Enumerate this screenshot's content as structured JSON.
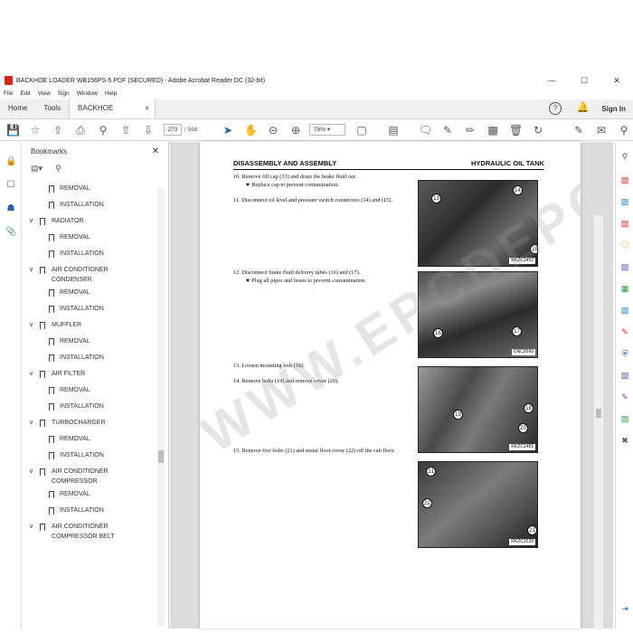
{
  "window": {
    "title": "BACKHOE LOADER WB156PS-5.PDF (SECURED) - Adobe Acrobat Reader DC (32-bit)",
    "controls": [
      "—",
      "☐",
      "✕"
    ]
  },
  "menu": [
    "File",
    "Edit",
    "View",
    "Sign",
    "Window",
    "Help"
  ],
  "tabs": {
    "home": "Home",
    "tools": "Tools",
    "doc": "BACKHOE LOADER...",
    "doc_close": "×",
    "sign_in": "Sign In"
  },
  "toolbar": {
    "page_current": "273",
    "page_total": "/ 568",
    "zoom": "78%"
  },
  "bookmarks": {
    "title": "Bookmarks",
    "items": [
      {
        "label": "REMOVAL",
        "level": 2
      },
      {
        "label": "INSTALLATION",
        "level": 2
      },
      {
        "label": "RADIATOR",
        "level": 1
      },
      {
        "label": "REMOVAL",
        "level": 2
      },
      {
        "label": "INSTALLATION",
        "level": 2
      },
      {
        "label": "AIR CONDITIONER",
        "label2": "CONDENSER",
        "level": 1
      },
      {
        "label": "REMOVAL",
        "level": 2
      },
      {
        "label": "INSTALLATION",
        "level": 2
      },
      {
        "label": "MUFFLER",
        "level": 1
      },
      {
        "label": "REMOVAL",
        "level": 2
      },
      {
        "label": "INSTALLATION",
        "level": 2
      },
      {
        "label": "AIR FILTER",
        "level": 1
      },
      {
        "label": "REMOVAL",
        "level": 2
      },
      {
        "label": "INSTALLATION",
        "level": 2
      },
      {
        "label": "TURBOCHARGER",
        "level": 1
      },
      {
        "label": "REMOVAL",
        "level": 2
      },
      {
        "label": "INSTALLATION",
        "level": 2
      },
      {
        "label": "AIR CONDITIONER",
        "label2": "COMPRESSOR",
        "level": 1
      },
      {
        "label": "REMOVAL",
        "level": 2
      },
      {
        "label": "INSTALLATION",
        "level": 2
      },
      {
        "label": "AIR CONDITIONER",
        "label2": "COMPRESSOR BELT",
        "level": 1
      }
    ]
  },
  "document": {
    "header_left": "DISASSEMBLY AND ASSEMBLY",
    "header_right": "HYDRAULIC OIL TANK",
    "steps": [
      {
        "num": "10.",
        "text": "Remove fill cap (13) and drain the brake fluid out.",
        "sub": "★   Replace cap to prevent contamination."
      },
      {
        "num": "11.",
        "text": "Disconnect oil level and pressure switch connectors (14) and (15)."
      },
      {
        "num": "12.",
        "text": "Disconnect brake fluid delivery tubes (16) and (17).",
        "sub": "★   Plug all pipes and hoses to prevent contamination."
      },
      {
        "num": "13.",
        "text": "Loosen mounting bolt (18)."
      },
      {
        "num": "14.",
        "text": "Remove bolts (19) and remove cover (20)."
      },
      {
        "num": "15.",
        "text": "Remove five bolts (21) and metal floor cover (22) off the cab floor."
      }
    ],
    "photos": [
      {
        "caption": "RKZC1452",
        "callouts": [
          "13",
          "14",
          "15"
        ]
      },
      {
        "caption": "ONC8560",
        "callouts": [
          "16",
          "17"
        ]
      },
      {
        "caption": "RKZC1481",
        "callouts": [
          "18",
          "19",
          "20"
        ]
      },
      {
        "caption": "RKZC1520",
        "callouts": [
          "21",
          "22",
          "21"
        ]
      }
    ],
    "watermark": "WWW.EPCDEPOT.COM"
  }
}
